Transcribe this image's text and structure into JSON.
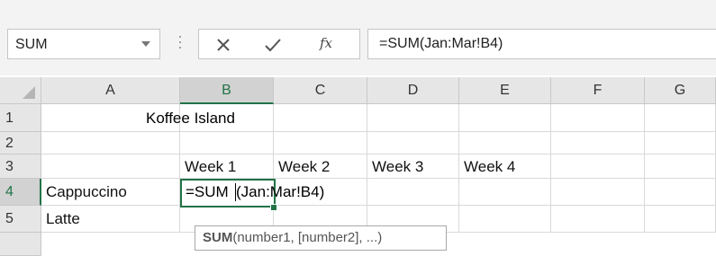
{
  "name_box": {
    "value": "SUM"
  },
  "formula_bar": {
    "cancel_icon": "cancel-x",
    "enter_icon": "check",
    "fx_label": "fx",
    "formula": "=SUM(Jan:Mar!B4)"
  },
  "columns": [
    "A",
    "B",
    "C",
    "D",
    "E",
    "F",
    "G"
  ],
  "selected_column": "B",
  "rows": [
    "1",
    "2",
    "3",
    "4",
    "5"
  ],
  "selected_row": "4",
  "cells": {
    "B1_title": "Koffee Island",
    "B3": "Week 1",
    "C3": "Week 2",
    "D3": "Week 3",
    "E3": "Week 4",
    "A4": "Cappuccino",
    "A5": "Latte",
    "B4_edit_fn": "=SUM",
    "B4_edit_args": "(Jan:Mar!B4)"
  },
  "tooltip": {
    "function_name": "SUM",
    "args": "(number1, [number2], ...)"
  },
  "colors": {
    "accent_green": "#217346",
    "header_bg": "#e6e6e6",
    "selected_header_bg": "#d2d2d2"
  }
}
